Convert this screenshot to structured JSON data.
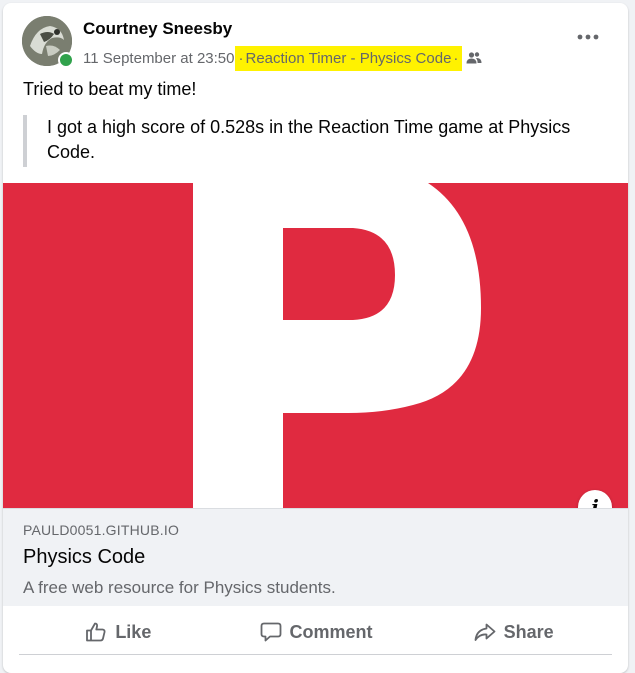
{
  "post": {
    "author": "Courtney Sneesby",
    "timestamp": "11 September at 23:50",
    "separator": "·",
    "shared_from": "Reaction Timer - Physics Code",
    "audience_icon": "friends-icon",
    "text": "Tried to beat my time!",
    "quote": "I got a high score of 0.528s in the Reaction Time game at Physics Code."
  },
  "link_preview": {
    "image_letter": "P",
    "image_bg_color": "#e02a40",
    "info_glyph": "i",
    "domain": "PAULD0051.GITHUB.IO",
    "title": "Physics Code",
    "description": "A free web resource for Physics students."
  },
  "actions": {
    "like": "Like",
    "comment": "Comment",
    "share": "Share"
  },
  "colors": {
    "online_indicator": "#31a24c",
    "highlight": "#fff200",
    "secondary_text": "#65676b"
  }
}
